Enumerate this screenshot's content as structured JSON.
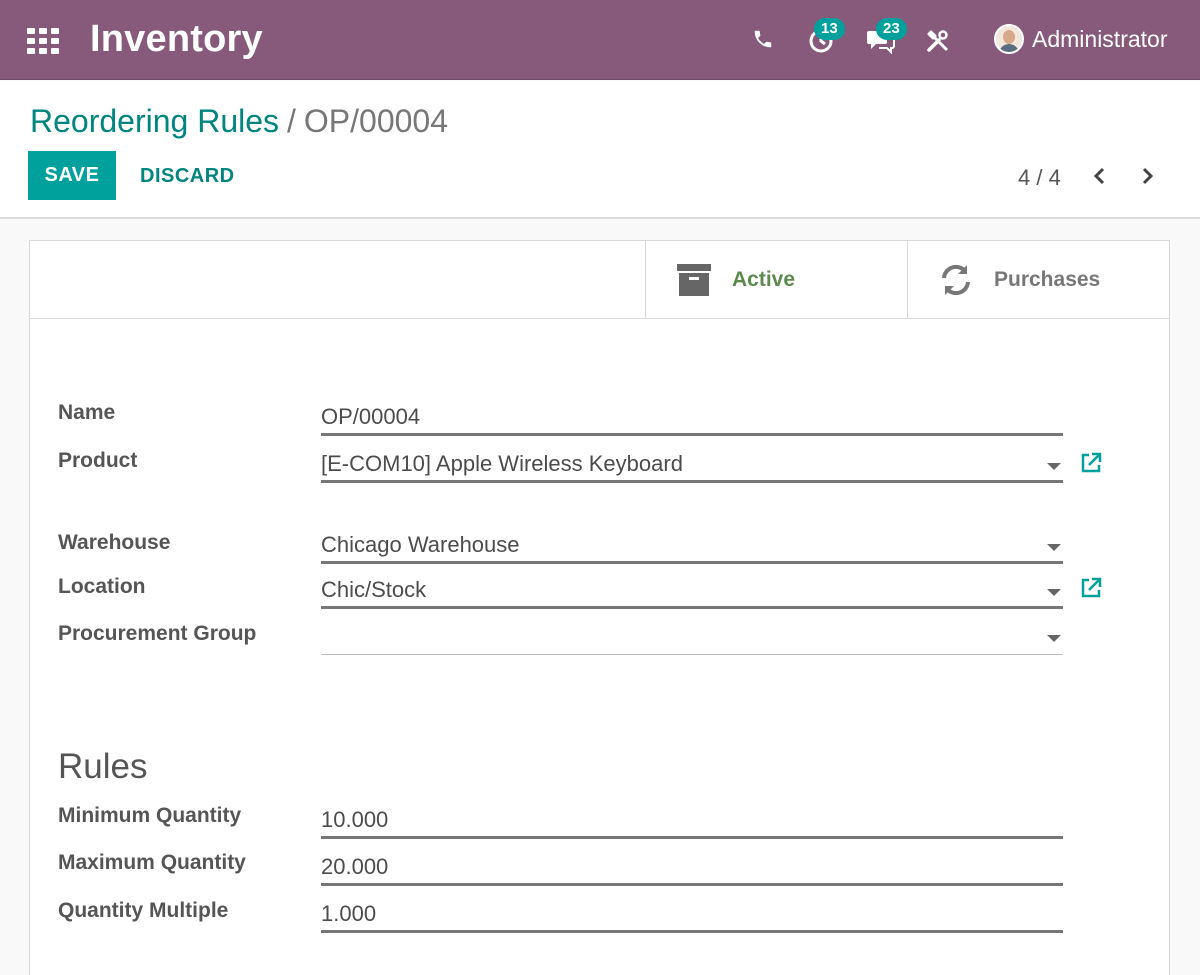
{
  "navbar": {
    "app_title": "Inventory",
    "activity_count": "13",
    "message_count": "23",
    "user_name": "Administrator",
    "icons": [
      "apps-icon",
      "phone-icon",
      "activity-clock-icon",
      "chat-icon",
      "tools-icon"
    ]
  },
  "control": {
    "breadcrumb_parent": "Reordering Rules",
    "breadcrumb_sep": "/",
    "breadcrumb_current": "OP/00004",
    "save_label": "SAVE",
    "discard_label": "DISCARD",
    "pager": "4 / 4"
  },
  "stat_buttons": {
    "active_label": "Active",
    "purchases_label": "Purchases"
  },
  "form": {
    "name_label": "Name",
    "name_value": "OP/00004",
    "product_label": "Product",
    "product_value": "[E-COM10] Apple Wireless Keyboard",
    "warehouse_label": "Warehouse",
    "warehouse_value": "Chicago Warehouse",
    "location_label": "Location",
    "location_value": "Chic/Stock",
    "procurement_group_label": "Procurement Group",
    "procurement_group_value": ""
  },
  "rules": {
    "title": "Rules",
    "min_label": "Minimum Quantity",
    "min_value": "10.000",
    "max_label": "Maximum Quantity",
    "max_value": "20.000",
    "multiple_label": "Quantity Multiple",
    "multiple_value": "1.000"
  },
  "colors": {
    "navbar": "#875a7b",
    "primary": "#00a09d",
    "link": "#00857f",
    "active": "#5c8a4d"
  }
}
